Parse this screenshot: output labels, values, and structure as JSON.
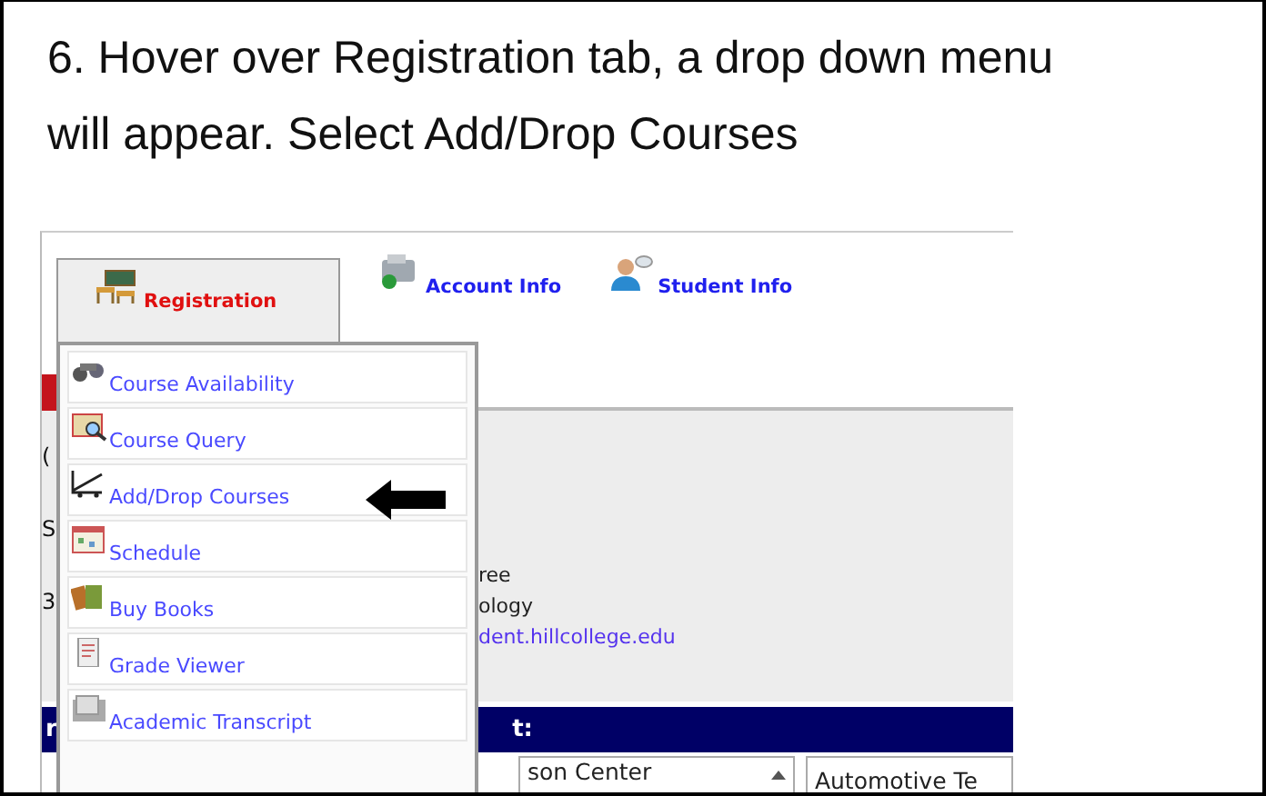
{
  "instruction": "6. Hover over Registration tab, a drop down menu will appear. Select Add/Drop Courses",
  "tabs": [
    {
      "label": "Registration",
      "selected": true,
      "kind": "desks"
    },
    {
      "label": "Account Info",
      "selected": false,
      "kind": "register"
    },
    {
      "label": "Student Info",
      "selected": false,
      "kind": "person"
    }
  ],
  "menu": [
    {
      "label": "Course Availability",
      "kind": "binoculars"
    },
    {
      "label": "Course Query",
      "kind": "map"
    },
    {
      "label": "Add/Drop Courses",
      "kind": "cart"
    },
    {
      "label": "Schedule",
      "kind": "calendar"
    },
    {
      "label": "Buy Books",
      "kind": "books"
    },
    {
      "label": "Grade Viewer",
      "kind": "document"
    },
    {
      "label": "Academic Transcript",
      "kind": "transcript"
    }
  ],
  "page": {
    "left_texts": [
      "(",
      "S",
      "3"
    ],
    "details": [
      "ree",
      "ology"
    ],
    "email": "dent.hillcollege.edu",
    "section_bar": {
      "left": "r",
      "right": "t:"
    },
    "listbox": "son Center",
    "field": "Automotive Te"
  }
}
